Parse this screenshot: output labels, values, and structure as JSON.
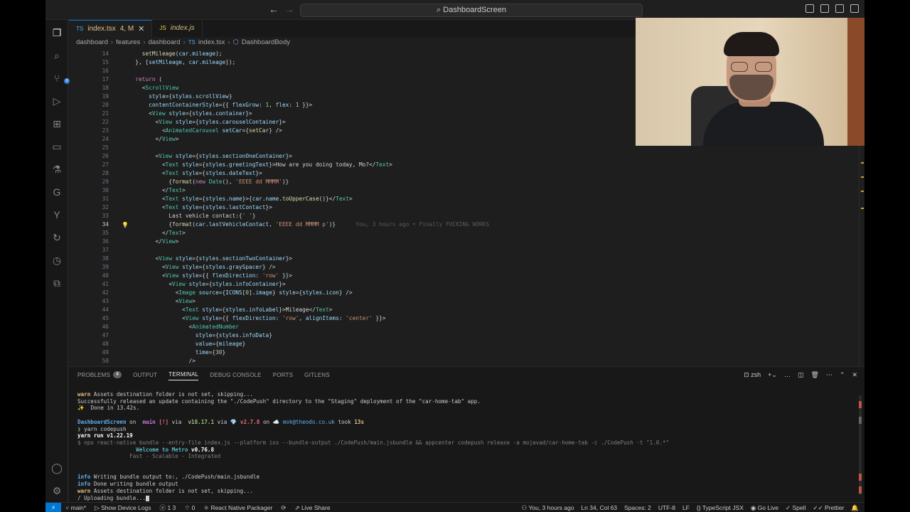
{
  "window": {
    "search_text": "DashboardScreen",
    "back_icon": "arrow-left-icon",
    "forward_icon": "arrow-right-icon"
  },
  "tabs": [
    {
      "label": "index.tsx",
      "status": "4, M",
      "icon": "typescript-icon"
    },
    {
      "label": "index.js",
      "icon": "javascript-icon"
    }
  ],
  "breadcrumb": [
    "dashboard",
    "features",
    "dashboard",
    "index.tsx",
    "DashboardBody"
  ],
  "editor": {
    "current_line": "34",
    "lines": [
      {
        "n": "14",
        "html": "    <span class=\"t-fn\">setMileage</span>(<span class=\"t-attr\">car</span>.<span class=\"t-attr\">mileage</span>);"
      },
      {
        "n": "15",
        "html": "  }, [<span class=\"t-attr\">setMileage</span>, <span class=\"t-attr\">car</span>.<span class=\"t-attr\">mileage</span>]);"
      },
      {
        "n": "16",
        "html": ""
      },
      {
        "n": "17",
        "html": "  <span class=\"t-kw\">return</span> ("
      },
      {
        "n": "18",
        "html": "    &lt;<span class=\"t-tag\">ScrollView</span>"
      },
      {
        "n": "19",
        "html": "      <span class=\"t-attr\">style</span>={<span class=\"t-attr\">styles</span>.<span class=\"t-attr\">scrollView</span>}"
      },
      {
        "n": "20",
        "html": "      <span class=\"t-attr\">contentContainerStyle</span>={{ <span class=\"t-attr\">flexGrow</span>: <span class=\"t-num\">1</span>, <span class=\"t-attr\">flex</span>: <span class=\"t-num\">1</span> }}&gt;"
      },
      {
        "n": "21",
        "html": "      &lt;<span class=\"t-tag\">View</span> <span class=\"t-attr\">style</span>={<span class=\"t-attr\">styles</span>.<span class=\"t-attr\">container</span>}&gt;"
      },
      {
        "n": "22",
        "html": "        &lt;<span class=\"t-tag\">View</span> <span class=\"t-attr\">style</span>={<span class=\"t-attr\">styles</span>.<span class=\"t-attr\">carouselContainer</span>}&gt;"
      },
      {
        "n": "23",
        "html": "          &lt;<span class=\"t-tag\">AnimatedCarousel</span> <span class=\"t-attr\">setCar</span>={<span class=\"t-fn\">setCar</span>} /&gt;"
      },
      {
        "n": "24",
        "html": "        &lt;/<span class=\"t-tag\">View</span>&gt;"
      },
      {
        "n": "25",
        "html": ""
      },
      {
        "n": "26",
        "html": "        &lt;<span class=\"t-tag\">View</span> <span class=\"t-attr\">style</span>={<span class=\"t-attr\">styles</span>.<span class=\"t-attr\">sectionOneContainer</span>}&gt;"
      },
      {
        "n": "27",
        "html": "          &lt;<span class=\"t-tag\">Text</span> <span class=\"t-attr\">style</span>={<span class=\"t-attr\">styles</span>.<span class=\"t-attr\">greetingText</span>}&gt;<span class=\"t-txt\">How are you doing today, Mo?</span>&lt;/<span class=\"t-tag\">Text</span>&gt;"
      },
      {
        "n": "28",
        "html": "          &lt;<span class=\"t-tag\">Text</span> <span class=\"t-attr\">style</span>={<span class=\"t-attr\">styles</span>.<span class=\"t-attr\">dateText</span>}&gt;"
      },
      {
        "n": "29",
        "html": "            {<span class=\"t-fn\">format</span>(<span class=\"t-kw\">new</span> <span class=\"t-tag\">Date</span>(), <span class=\"t-str\">'EEEE dd MMMM'</span>)}"
      },
      {
        "n": "30",
        "html": "          &lt;/<span class=\"t-tag\">Text</span>&gt;"
      },
      {
        "n": "31",
        "html": "          &lt;<span class=\"t-tag\">Text</span> <span class=\"t-attr\">style</span>={<span class=\"t-attr\">styles</span>.<span class=\"t-attr\">name</span>}&gt;{<span class=\"t-attr\">car</span>.<span class=\"t-attr\">name</span>.<span class=\"t-fn\">toUpperCase</span>()}&lt;/<span class=\"t-tag\">Text</span>&gt;"
      },
      {
        "n": "32",
        "html": "          &lt;<span class=\"t-tag\">Text</span> <span class=\"t-attr\">style</span>={<span class=\"t-attr\">styles</span>.<span class=\"t-attr\">lastContact</span>}&gt;"
      },
      {
        "n": "33",
        "html": "            <span class=\"t-txt\">Last vehicle contact:</span>{<span class=\"t-str\">' '</span>}"
      },
      {
        "n": "34",
        "html": "            {<span class=\"t-fn\">format</span>(<span class=\"t-attr\">car</span>.<span class=\"t-attr\">lastVehicleContact</span>, <span class=\"t-str\">'EEEE dd MMMM p'</span>)}      <span class=\"ghost\">You, 3 hours ago • Finally FUCKING WORKS</span>"
      },
      {
        "n": "35",
        "html": "          &lt;/<span class=\"t-tag\">Text</span>&gt;"
      },
      {
        "n": "36",
        "html": "        &lt;/<span class=\"t-tag\">View</span>&gt;"
      },
      {
        "n": "37",
        "html": ""
      },
      {
        "n": "38",
        "html": "        &lt;<span class=\"t-tag\">View</span> <span class=\"t-attr\">style</span>={<span class=\"t-attr\">styles</span>.<span class=\"t-attr\">sectionTwoContainer</span>}&gt;"
      },
      {
        "n": "39",
        "html": "          &lt;<span class=\"t-tag\">View</span> <span class=\"t-attr\">style</span>={<span class=\"t-attr\">styles</span>.<span class=\"t-attr\">graySpacer</span>} /&gt;"
      },
      {
        "n": "40",
        "html": "          &lt;<span class=\"t-tag\">View</span> <span class=\"t-attr\">style</span>={{ <span class=\"t-attr\">flexDirection</span>: <span class=\"t-str\">'row'</span> }}&gt;"
      },
      {
        "n": "41",
        "html": "            &lt;<span class=\"t-tag\">View</span> <span class=\"t-attr\">style</span>={<span class=\"t-attr\">styles</span>.<span class=\"t-attr\">infoContainer</span>}&gt;"
      },
      {
        "n": "42",
        "html": "              &lt;<span class=\"t-tag\">Image</span> <span class=\"t-attr\">source</span>={<span class=\"t-attr\">ICONS</span>[<span class=\"t-num\">0</span>].<span class=\"t-attr\">image</span>} <span class=\"t-attr\">style</span>={<span class=\"t-attr\">styles</span>.<span class=\"t-attr\">icon</span>} /&gt;"
      },
      {
        "n": "43",
        "html": "              &lt;<span class=\"t-tag\">View</span>&gt;"
      },
      {
        "n": "44",
        "html": "                &lt;<span class=\"t-tag\">Text</span> <span class=\"t-attr\">style</span>={<span class=\"t-attr\">styles</span>.<span class=\"t-attr\">infoLabel</span>}&gt;<span class=\"t-txt\">Mileage</span>&lt;/<span class=\"t-tag\">Text</span>&gt;"
      },
      {
        "n": "45",
        "html": "                &lt;<span class=\"t-tag\">View</span> <span class=\"t-attr\">style</span>={{ <span class=\"t-attr\">flexDirection</span>: <span class=\"t-str\">'row'</span>, <span class=\"t-attr\">alignItems</span>: <span class=\"t-str\">'center'</span> }}&gt;"
      },
      {
        "n": "46",
        "html": "                  &lt;<span class=\"t-tag\">AnimatedNumber</span>"
      },
      {
        "n": "47",
        "html": "                    <span class=\"t-attr\">style</span>={<span class=\"t-attr\">styles</span>.<span class=\"t-attr\">infoData</span>}"
      },
      {
        "n": "48",
        "html": "                    <span class=\"t-attr\">value</span>={<span class=\"t-attr\">mileage</span>}"
      },
      {
        "n": "49",
        "html": "                    <span class=\"t-attr\">time</span>={<span class=\"t-num\">30</span>}"
      },
      {
        "n": "50",
        "html": "                  /&gt;"
      }
    ]
  },
  "panel": {
    "tabs": [
      {
        "label": "PROBLEMS",
        "badge": "4"
      },
      {
        "label": "OUTPUT"
      },
      {
        "label": "TERMINAL"
      },
      {
        "label": "DEBUG CONSOLE"
      },
      {
        "label": "PORTS"
      },
      {
        "label": "GITLENS"
      }
    ],
    "shell": "zsh",
    "terminal_lines": [
      "<span class=\"y-warn\">warn</span> Assets destination folder is not set, skipping...",
      "Successfully released an update containing the \"./CodePush\" directory to the \"Staging\" deployment of the \"car-home-tab\" app.",
      "✨  Done in 13.42s.",
      "",
      "<span class=\"c-info\">DashboardScreen</span> on <span class=\"c-mag\"> main</span> <span class=\"c-red\">[!]</span> via <span class=\"c-green\"> v18.17.1</span> via <span class=\"c-red\">💎 v2.7.8</span> on <span class=\"c-blue\">☁️</span> <span class=\"c-blue\">mok@theodo.co.uk</span> took <span class=\"y-warn\">13s</span>",
      "<span class=\"c-green\">❯</span> yarn codepush",
      "<span class=\"c-bold\">yarn run v1.22.19</span>",
      "<span class=\"c-dim\">$ npx react-native bundle --entry-file index.js --platform ios --bundle-output ./CodePush/main.jsbundle && appcenter codepush release -a mojavad/car-home-tab -c ./CodePush -t \"1.0.*\"</span>",
      "                  <span class=\"c-cyan\">Welcome to Metro</span> <span class=\"c-bold\">v0.76.8</span>",
      "                <span class=\"c-dim\">Fast - Scalable - Integrated</span>",
      "",
      "",
      "<span class=\"c-info\">info</span> Writing bundle output to:, ./CodePush/main.jsbundle",
      "<span class=\"c-info\">info</span> Done writing bundle output",
      "<span class=\"y-warn\">warn</span> Assets destination folder is not set, skipping...",
      "/ Uploading bundle..."
    ]
  },
  "statusbar": {
    "left": [
      "main*",
      "Show Device Logs",
      "1  3",
      "0",
      "React Native Packager",
      "Live Share"
    ],
    "right": [
      "You, 3 hours ago",
      "Ln 34, Col 63",
      "Spaces: 2",
      "UTF-8",
      "LF",
      "TypeScript JSX",
      "Go Live",
      "Spell",
      "Prettier"
    ]
  },
  "colors": {
    "accent": "#0078d4",
    "editor_bg": "#1e1e1e",
    "panel_bg": "#181818"
  }
}
